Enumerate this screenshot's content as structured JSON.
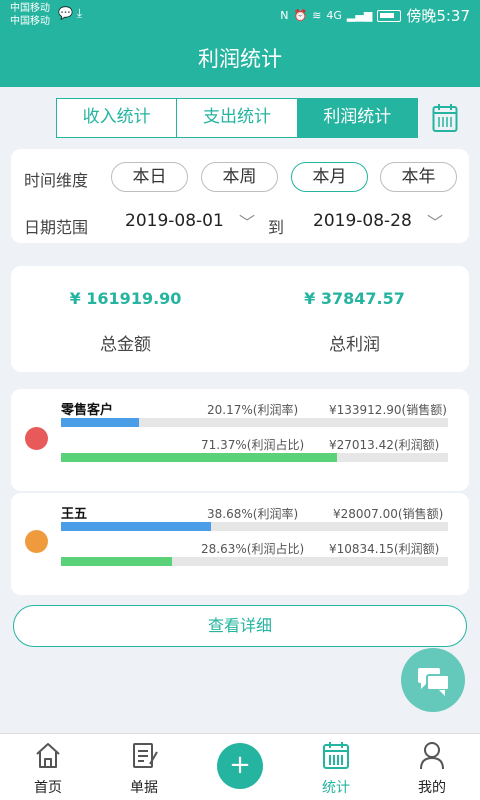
{
  "status_bar": {
    "carrier1": "中国移动",
    "carrier2": "中国移动",
    "network": "4G",
    "time": "傍晚5:37"
  },
  "header": {
    "title": "利润统计"
  },
  "tabs": [
    {
      "label": "收入统计",
      "active": false
    },
    {
      "label": "支出统计",
      "active": false
    },
    {
      "label": "利润统计",
      "active": true
    }
  ],
  "filter": {
    "dimension_label": "时间维度",
    "options": [
      "本日",
      "本周",
      "本月",
      "本年"
    ],
    "selected": "本月",
    "range_label": "日期范围",
    "start_date": "2019-08-01",
    "to_label": "到",
    "end_date": "2019-08-28"
  },
  "totals": {
    "amount_value": "¥ 161919.90",
    "amount_label": "总金额",
    "profit_value": "¥ 37847.57",
    "profit_label": "总利润"
  },
  "customers": [
    {
      "name": "零售客户",
      "dot_color": "#e85a5a",
      "profit_rate_text": "20.17%(利润率)",
      "sales_text": "¥133912.90(销售额)",
      "profit_share_text": "71.37%(利润占比)",
      "profit_text": "¥27013.42(利润额)",
      "profit_rate": 20.17,
      "profit_share": 71.37
    },
    {
      "name": "王五",
      "dot_color": "#f09a3e",
      "profit_rate_text": "38.68%(利润率)",
      "sales_text": "¥28007.00(销售额)",
      "profit_share_text": "28.63%(利润占比)",
      "profit_text": "¥10834.15(利润额)",
      "profit_rate": 38.68,
      "profit_share": 28.63
    }
  ],
  "detail_button": "查看详细",
  "colors": {
    "accent": "#25b4a0",
    "bar_blue": "#4a9ee8",
    "bar_green": "#5bd17a"
  },
  "bottom_nav": [
    {
      "label": "首页",
      "icon": "home-icon"
    },
    {
      "label": "单据",
      "icon": "document-icon"
    },
    {
      "label": "统计",
      "icon": "stats-icon",
      "active": true
    },
    {
      "label": "我的",
      "icon": "user-icon"
    }
  ]
}
